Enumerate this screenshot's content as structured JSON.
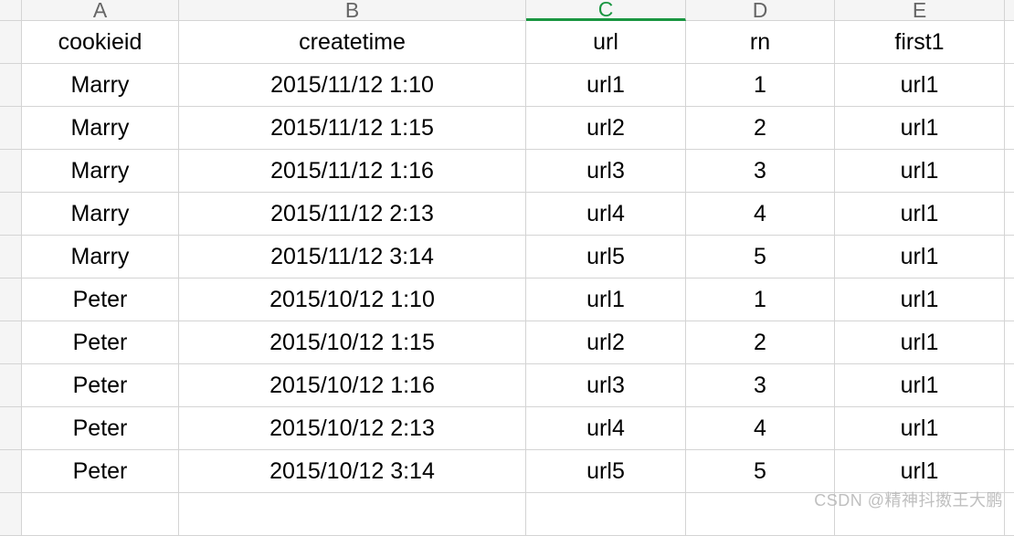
{
  "chart_data": {
    "type": "table",
    "columns": [
      "cookieid",
      "createtime",
      "url",
      "rn",
      "first1"
    ],
    "rows": [
      [
        "Marry",
        "2015/11/12 1:10",
        "url1",
        1,
        "url1"
      ],
      [
        "Marry",
        "2015/11/12 1:15",
        "url2",
        2,
        "url1"
      ],
      [
        "Marry",
        "2015/11/12 1:16",
        "url3",
        3,
        "url1"
      ],
      [
        "Marry",
        "2015/11/12 2:13",
        "url4",
        4,
        "url1"
      ],
      [
        "Marry",
        "2015/11/12 3:14",
        "url5",
        5,
        "url1"
      ],
      [
        "Peter",
        "2015/10/12 1:10",
        "url1",
        1,
        "url1"
      ],
      [
        "Peter",
        "2015/10/12 1:15",
        "url2",
        2,
        "url1"
      ],
      [
        "Peter",
        "2015/10/12 1:16",
        "url3",
        3,
        "url1"
      ],
      [
        "Peter",
        "2015/10/12 2:13",
        "url4",
        4,
        "url1"
      ],
      [
        "Peter",
        "2015/10/12 3:14",
        "url5",
        5,
        "url1"
      ]
    ]
  },
  "col_letters": [
    "A",
    "B",
    "C",
    "D",
    "E"
  ],
  "selected_column_index": 2,
  "watermark": "CSDN @精神抖擞王大鹏"
}
